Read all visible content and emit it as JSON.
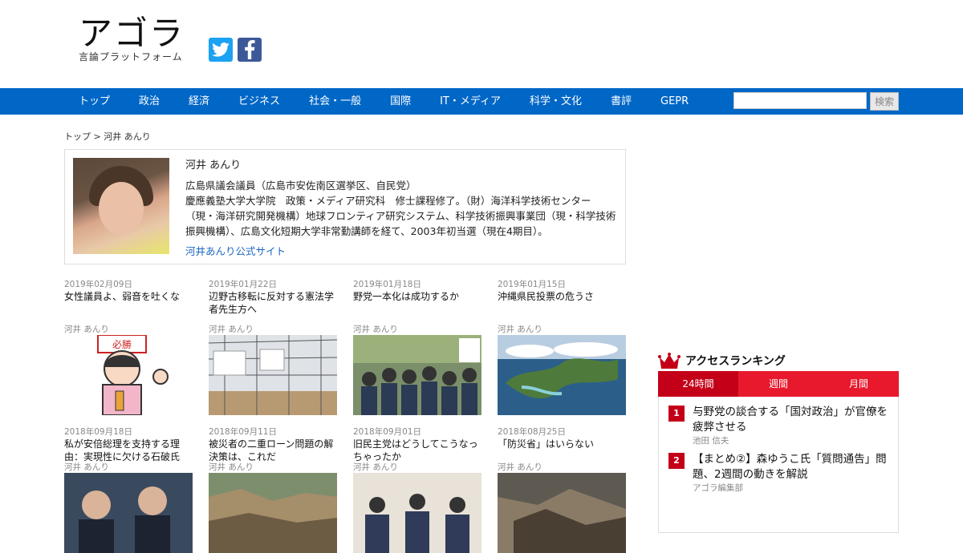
{
  "header": {
    "logo_main": "アゴラ",
    "logo_sub": "言論プラットフォーム",
    "social": [
      "twitter-icon",
      "facebook-icon"
    ]
  },
  "nav": {
    "items": [
      "トップ",
      "政治",
      "経済",
      "ビジネス",
      "社会・一般",
      "国際",
      "IT・メディア",
      "科学・文化",
      "書評",
      "GEPR"
    ],
    "search_button": "検索",
    "search_value": ""
  },
  "breadcrumb": "トップ > 河井 あんり",
  "profile": {
    "name": "河井 あんり",
    "line1": "広島県議会議員（広島市安佐南区選挙区、自民党）",
    "line2": "慶應義塾大学大学院　政策・メディア研究科　修士課程修了。（財）海洋科学技術センター（現・海洋研究開発機構）地球フロンティア研究システム、科学技術振興事業団（現・科学技術振興機構）、広島文化短期大学非常勤講師を経て、2003年初当選（現在4期目）。",
    "link": "河井あんり公式サイト"
  },
  "articles": [
    {
      "date": "2019年02月09日",
      "title": "女性議員よ、弱音を吐くな",
      "author": "河井 あんり"
    },
    {
      "date": "2019年01月22日",
      "title": "辺野古移転に反対する憲法学者先生方へ",
      "author": "河井 あんり"
    },
    {
      "date": "2019年01月18日",
      "title": "野党一本化は成功するか",
      "author": "河井 あんり"
    },
    {
      "date": "2019年01月15日",
      "title": "沖縄県民投票の危うさ",
      "author": "河井 あんり"
    },
    {
      "date": "2018年09月18日",
      "title": "私が安倍総理を支持する理由：実現性に欠ける石破氏",
      "author": "河井 あんり"
    },
    {
      "date": "2018年09月11日",
      "title": "被災者の二重ローン問題の解決策は、これだ",
      "author": "河井 あんり"
    },
    {
      "date": "2018年09月01日",
      "title": "旧民主党はどうしてこうなっちゃったか",
      "author": "河井 あんり"
    },
    {
      "date": "2018年08月25日",
      "title": "「防災省」はいらない",
      "author": "河井 あんり"
    }
  ],
  "ranking": {
    "title": "アクセスランキング",
    "tabs": [
      "24時間",
      "週間",
      "月間"
    ],
    "items": [
      {
        "num": "1",
        "title": "与野党の談合する「国対政治」が官僚を疲弊させる",
        "author": "池田 信夫"
      },
      {
        "num": "2",
        "title": "【まとめ②】森ゆうこ氏「質問通告」問題、2週間の動きを解説",
        "author": "アゴラ編集部"
      }
    ]
  },
  "colors": {
    "nav": "#0067c7",
    "ranking": "#e8192c",
    "ranking_active": "#c40018",
    "link": "#1a66c2"
  }
}
